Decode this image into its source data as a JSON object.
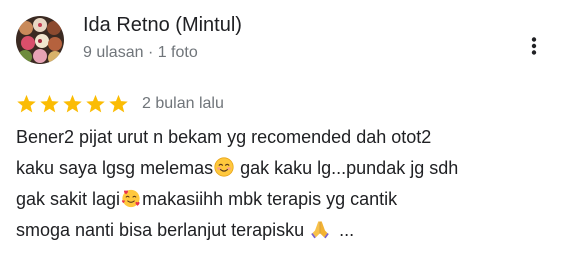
{
  "review": {
    "author": {
      "name": "Ida Retno (Mintul)",
      "meta": "9 ulasan · 1 foto",
      "avatar_icon": "avatar-photo-cakes"
    },
    "more_icon": "more-vert-icon",
    "rating": {
      "stars": 5,
      "max_stars": 5,
      "star_color": "#fbbc04"
    },
    "date": "2 bulan lalu",
    "text": {
      "line1": "Bener2 pijat urut n bekam yg recomended dah otot2",
      "line2_before": "kaku saya lgsg melemas",
      "line2_emoji": "smiling-face-emoji",
      "line2_after": " gak kaku lg...pundak jg sdh",
      "line3_before": "gak sakit lagi",
      "line3_emoji": "smiling-face-with-hearts-emoji",
      "line3_after": "makasiihh mbk terapis yg cantik",
      "line4_before": "smoga nanti bisa berlanjut terapisku ",
      "line4_emoji": "folded-hands-emoji",
      "ellipsis": "..."
    }
  },
  "colors": {
    "text_primary": "#202124",
    "text_secondary": "#70757a",
    "star": "#fbbc04"
  }
}
